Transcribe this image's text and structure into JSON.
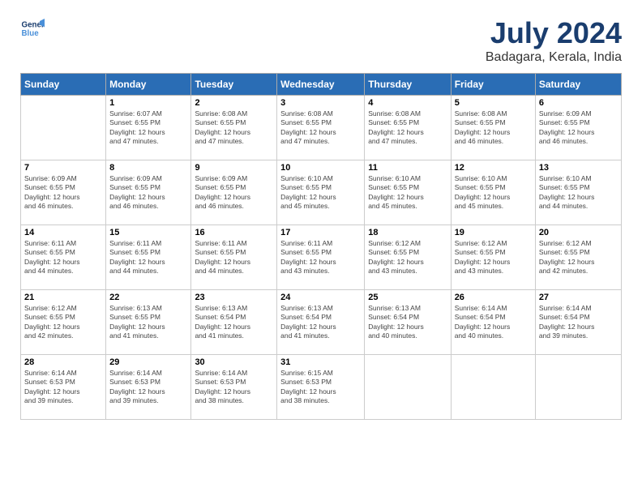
{
  "logo": {
    "line1": "General",
    "line2": "Blue"
  },
  "title": "July 2024",
  "location": "Badagara, Kerala, India",
  "days_of_week": [
    "Sunday",
    "Monday",
    "Tuesday",
    "Wednesday",
    "Thursday",
    "Friday",
    "Saturday"
  ],
  "weeks": [
    [
      {
        "day": "",
        "info": ""
      },
      {
        "day": "1",
        "info": "Sunrise: 6:07 AM\nSunset: 6:55 PM\nDaylight: 12 hours\nand 47 minutes."
      },
      {
        "day": "2",
        "info": "Sunrise: 6:08 AM\nSunset: 6:55 PM\nDaylight: 12 hours\nand 47 minutes."
      },
      {
        "day": "3",
        "info": "Sunrise: 6:08 AM\nSunset: 6:55 PM\nDaylight: 12 hours\nand 47 minutes."
      },
      {
        "day": "4",
        "info": "Sunrise: 6:08 AM\nSunset: 6:55 PM\nDaylight: 12 hours\nand 47 minutes."
      },
      {
        "day": "5",
        "info": "Sunrise: 6:08 AM\nSunset: 6:55 PM\nDaylight: 12 hours\nand 46 minutes."
      },
      {
        "day": "6",
        "info": "Sunrise: 6:09 AM\nSunset: 6:55 PM\nDaylight: 12 hours\nand 46 minutes."
      }
    ],
    [
      {
        "day": "7",
        "info": "Sunrise: 6:09 AM\nSunset: 6:55 PM\nDaylight: 12 hours\nand 46 minutes."
      },
      {
        "day": "8",
        "info": "Sunrise: 6:09 AM\nSunset: 6:55 PM\nDaylight: 12 hours\nand 46 minutes."
      },
      {
        "day": "9",
        "info": "Sunrise: 6:09 AM\nSunset: 6:55 PM\nDaylight: 12 hours\nand 46 minutes."
      },
      {
        "day": "10",
        "info": "Sunrise: 6:10 AM\nSunset: 6:55 PM\nDaylight: 12 hours\nand 45 minutes."
      },
      {
        "day": "11",
        "info": "Sunrise: 6:10 AM\nSunset: 6:55 PM\nDaylight: 12 hours\nand 45 minutes."
      },
      {
        "day": "12",
        "info": "Sunrise: 6:10 AM\nSunset: 6:55 PM\nDaylight: 12 hours\nand 45 minutes."
      },
      {
        "day": "13",
        "info": "Sunrise: 6:10 AM\nSunset: 6:55 PM\nDaylight: 12 hours\nand 44 minutes."
      }
    ],
    [
      {
        "day": "14",
        "info": "Sunrise: 6:11 AM\nSunset: 6:55 PM\nDaylight: 12 hours\nand 44 minutes."
      },
      {
        "day": "15",
        "info": "Sunrise: 6:11 AM\nSunset: 6:55 PM\nDaylight: 12 hours\nand 44 minutes."
      },
      {
        "day": "16",
        "info": "Sunrise: 6:11 AM\nSunset: 6:55 PM\nDaylight: 12 hours\nand 44 minutes."
      },
      {
        "day": "17",
        "info": "Sunrise: 6:11 AM\nSunset: 6:55 PM\nDaylight: 12 hours\nand 43 minutes."
      },
      {
        "day": "18",
        "info": "Sunrise: 6:12 AM\nSunset: 6:55 PM\nDaylight: 12 hours\nand 43 minutes."
      },
      {
        "day": "19",
        "info": "Sunrise: 6:12 AM\nSunset: 6:55 PM\nDaylight: 12 hours\nand 43 minutes."
      },
      {
        "day": "20",
        "info": "Sunrise: 6:12 AM\nSunset: 6:55 PM\nDaylight: 12 hours\nand 42 minutes."
      }
    ],
    [
      {
        "day": "21",
        "info": "Sunrise: 6:12 AM\nSunset: 6:55 PM\nDaylight: 12 hours\nand 42 minutes."
      },
      {
        "day": "22",
        "info": "Sunrise: 6:13 AM\nSunset: 6:55 PM\nDaylight: 12 hours\nand 41 minutes."
      },
      {
        "day": "23",
        "info": "Sunrise: 6:13 AM\nSunset: 6:54 PM\nDaylight: 12 hours\nand 41 minutes."
      },
      {
        "day": "24",
        "info": "Sunrise: 6:13 AM\nSunset: 6:54 PM\nDaylight: 12 hours\nand 41 minutes."
      },
      {
        "day": "25",
        "info": "Sunrise: 6:13 AM\nSunset: 6:54 PM\nDaylight: 12 hours\nand 40 minutes."
      },
      {
        "day": "26",
        "info": "Sunrise: 6:14 AM\nSunset: 6:54 PM\nDaylight: 12 hours\nand 40 minutes."
      },
      {
        "day": "27",
        "info": "Sunrise: 6:14 AM\nSunset: 6:54 PM\nDaylight: 12 hours\nand 39 minutes."
      }
    ],
    [
      {
        "day": "28",
        "info": "Sunrise: 6:14 AM\nSunset: 6:53 PM\nDaylight: 12 hours\nand 39 minutes."
      },
      {
        "day": "29",
        "info": "Sunrise: 6:14 AM\nSunset: 6:53 PM\nDaylight: 12 hours\nand 39 minutes."
      },
      {
        "day": "30",
        "info": "Sunrise: 6:14 AM\nSunset: 6:53 PM\nDaylight: 12 hours\nand 38 minutes."
      },
      {
        "day": "31",
        "info": "Sunrise: 6:15 AM\nSunset: 6:53 PM\nDaylight: 12 hours\nand 38 minutes."
      },
      {
        "day": "",
        "info": ""
      },
      {
        "day": "",
        "info": ""
      },
      {
        "day": "",
        "info": ""
      }
    ]
  ]
}
